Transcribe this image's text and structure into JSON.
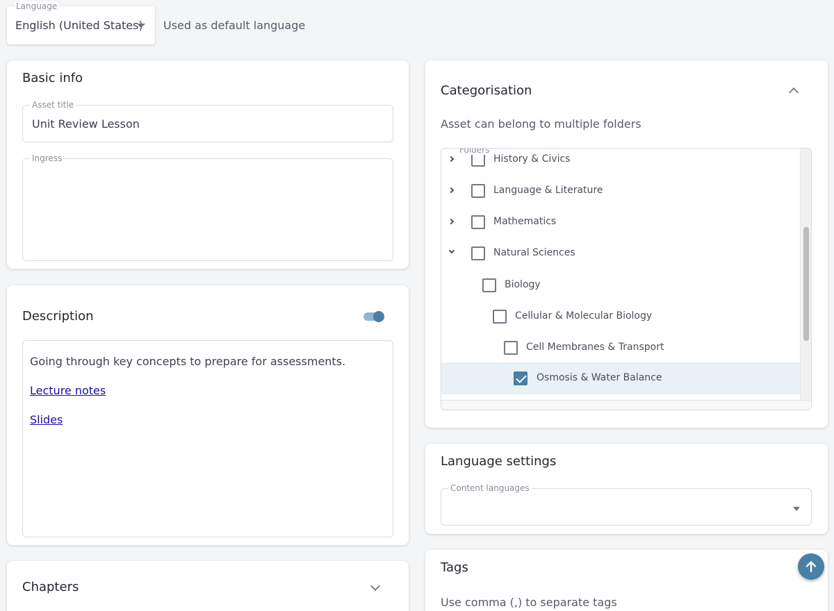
{
  "language": {
    "legend": "Language",
    "value": "English (United States)",
    "help": "Used as default language"
  },
  "basic_info": {
    "title": "Basic info",
    "asset_title_label": "Asset title",
    "asset_title_value": "Unit Review Lesson",
    "ingress_label": "Ingress",
    "ingress_value": ""
  },
  "description": {
    "title": "Description",
    "toggle_on": true,
    "text": "Going through key concepts to prepare for assessments.",
    "links": [
      "Lecture notes",
      "Slides"
    ]
  },
  "chapters": {
    "title": "Chapters"
  },
  "categorisation": {
    "title": "Categorisation",
    "subtitle": "Asset can belong to multiple folders",
    "folders_label": "Folders",
    "folders": [
      {
        "label": "History & Civics",
        "expander": "closed",
        "checked": false
      },
      {
        "label": "Language & Literature",
        "expander": "closed",
        "checked": false
      },
      {
        "label": "Mathematics",
        "expander": "closed",
        "checked": false
      },
      {
        "label": "Natural Sciences",
        "expander": "open",
        "checked": false
      },
      {
        "label": "Biology",
        "expander": "none",
        "checked": false
      },
      {
        "label": "Cellular & Molecular Biology",
        "expander": "none",
        "checked": false
      },
      {
        "label": "Cell Membranes & Transport",
        "expander": "none",
        "checked": false
      },
      {
        "label": "Osmosis & Water Balance",
        "expander": "none",
        "checked": true
      }
    ]
  },
  "language_settings": {
    "title": "Language settings",
    "content_languages_label": "Content languages"
  },
  "tags": {
    "title": "Tags",
    "subtitle": "Use comma (,) to separate tags"
  },
  "colors": {
    "accent": "#4a7fa6",
    "selected_row": "#e8f1f5",
    "link": "#1a0dab"
  }
}
